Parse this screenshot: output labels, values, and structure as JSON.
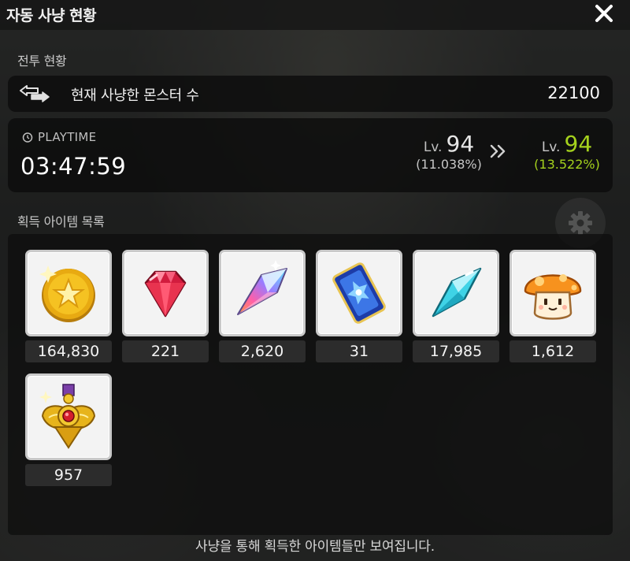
{
  "window": {
    "title": "자동 사냥 현황"
  },
  "battle": {
    "section_label": "전투 현황",
    "monster_label": "현재 사냥한 몬스터 수",
    "monster_count": "22100"
  },
  "playtime": {
    "label": "PLAYTIME",
    "time": "03:47:59",
    "level_prefix": "Lv.",
    "level_before": "94",
    "percent_before": "(11.038%)",
    "level_after": "94",
    "percent_after": "(13.522%)"
  },
  "items": {
    "section_label": "획득 아이템 목록",
    "list": [
      {
        "icon": "meso-coin-icon",
        "qty": "164,830"
      },
      {
        "icon": "red-gem-icon",
        "qty": "221"
      },
      {
        "icon": "rainbow-crystal-icon",
        "qty": "2,620"
      },
      {
        "icon": "blue-card-icon",
        "qty": "31"
      },
      {
        "icon": "cyan-crystal-icon",
        "qty": "17,985"
      },
      {
        "icon": "orange-mushroom-icon",
        "qty": "1,612"
      },
      {
        "icon": "gold-medal-icon",
        "qty": "957"
      }
    ]
  },
  "footer": {
    "note": "사냥을 통해 획득한 아이템들만 보여집니다."
  },
  "colors": {
    "level_up_green": "#a5d21d",
    "panel_dark": "#141414",
    "slot_bg": "#f3f3f3"
  }
}
